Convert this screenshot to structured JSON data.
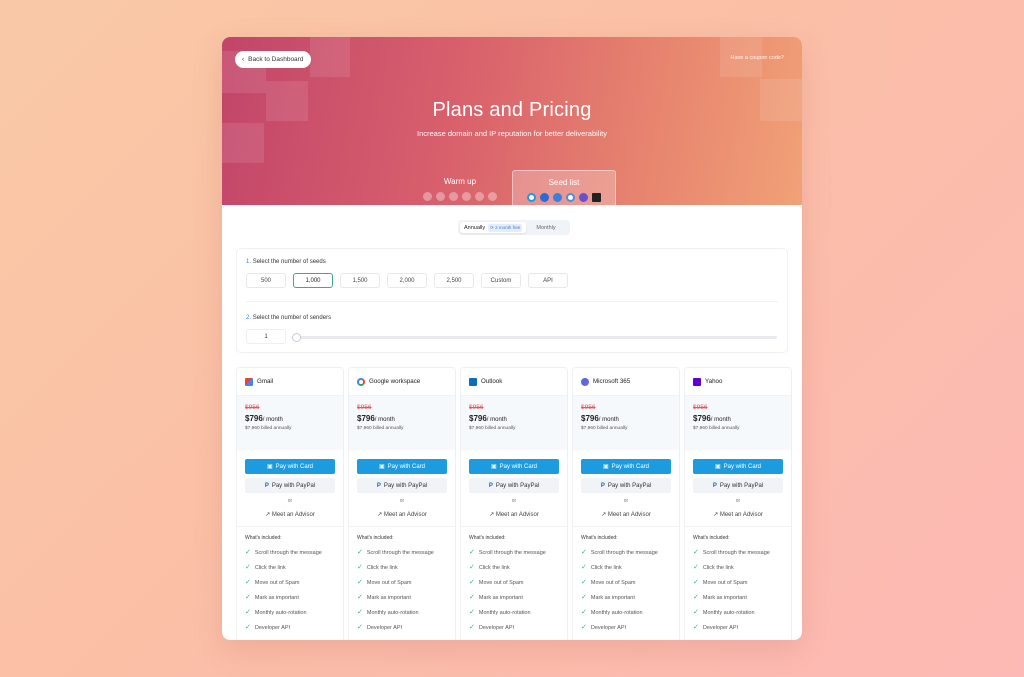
{
  "header": {
    "back_label": "Back to Dashboard",
    "coupon_label": "Have a coupon code?",
    "title": "Plans and Pricing",
    "subtitle": "Increase domain and IP reputation for better deliverability"
  },
  "tabs": [
    {
      "label": "Warm up",
      "active": false
    },
    {
      "label": "Seed list",
      "active": true
    }
  ],
  "billing_toggle": {
    "annual_label": "Annually",
    "annual_badge": "2 month free",
    "monthly_label": "Monthly",
    "selected": "Annually"
  },
  "seeds_step": {
    "number": "1.",
    "label": "Select the number of seeds",
    "options": [
      "500",
      "1,000",
      "1,500",
      "2,000",
      "2,500",
      "Custom",
      "API"
    ],
    "selected": "1,000"
  },
  "senders_step": {
    "number": "2.",
    "label": "Select the number of senders",
    "value": "1",
    "slider_fraction": 0
  },
  "plans": [
    {
      "provider": "Gmail",
      "icon": "gmail-icon",
      "old_price": "$956",
      "price": "$796",
      "per": "/ month",
      "billed": "$7,960 billed annually"
    },
    {
      "provider": "Google workspace",
      "icon": "google-icon",
      "old_price": "$956",
      "price": "$796",
      "per": "/ month",
      "billed": "$7,960 billed annually"
    },
    {
      "provider": "Outlook",
      "icon": "outlook-icon",
      "old_price": "$956",
      "price": "$796",
      "per": "/ month",
      "billed": "$7,960 billed annually"
    },
    {
      "provider": "Microsoft 365",
      "icon": "microsoft-365-icon",
      "old_price": "$956",
      "price": "$796",
      "per": "/ month",
      "billed": "$7,960 billed annually"
    },
    {
      "provider": "Yahoo",
      "icon": "yahoo-icon",
      "old_price": "$956",
      "price": "$796",
      "per": "/ month",
      "billed": "$7,960 billed annually"
    }
  ],
  "card_actions": {
    "pay_card": "Pay with Card",
    "pay_paypal": "Pay with PayPal",
    "or": "or",
    "advisor": "Meet an Advisor",
    "included_title": "What's included:"
  },
  "features": [
    "Scroll through the message",
    "Click the link",
    "Move out of Spam",
    "Mark as important",
    "Monthly auto-rotation",
    "Developer API"
  ],
  "colors": {
    "accent": "#1d9be0",
    "check": "#3fa88b",
    "old_price": "#e05a5a",
    "hero_start": "#c2456a",
    "hero_end": "#f1a177"
  }
}
